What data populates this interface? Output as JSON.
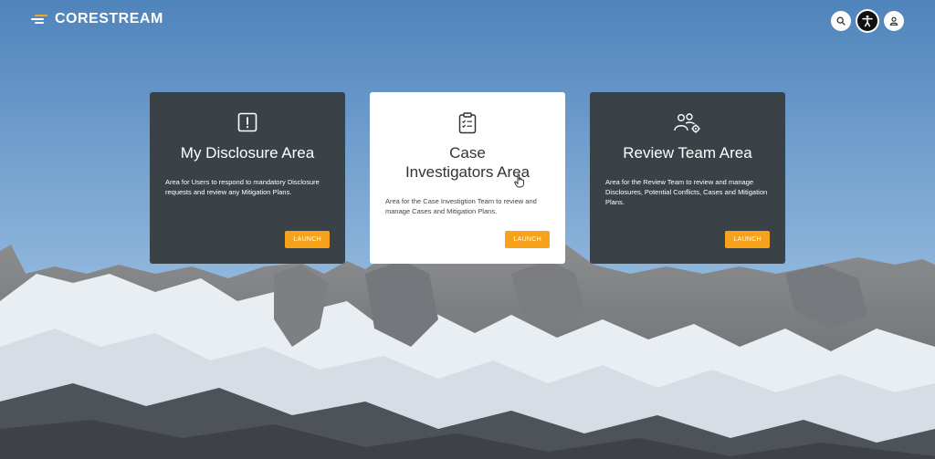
{
  "header": {
    "brand": "CORESTREAM",
    "icons": [
      "search-icon",
      "accessibility-icon",
      "user-icon"
    ]
  },
  "cards": [
    {
      "icon": "alert-icon",
      "title": "My Disclosure Area",
      "description": "Area for Users to respond to mandatory Disclosure requests and review any Mitigation Plans.",
      "button": "LAUNCH",
      "theme": "dark"
    },
    {
      "icon": "clipboard-checklist-icon",
      "title": "Case Investigators Area",
      "description": "Area for the Case Investigtion Team to review and manage Cases and Mitigation Plans.",
      "button": "LAUNCH",
      "theme": "light"
    },
    {
      "icon": "team-settings-icon",
      "title": "Review Team Area",
      "description": "Area for the Review Team to review and manage Disclosures, Potential Conflicts, Cases and Mitigation Plans.",
      "button": "LAUNCH",
      "theme": "dark"
    }
  ],
  "colors": {
    "accent": "#f7a21b",
    "card_dark": "#3b4247",
    "card_light": "#ffffff"
  }
}
